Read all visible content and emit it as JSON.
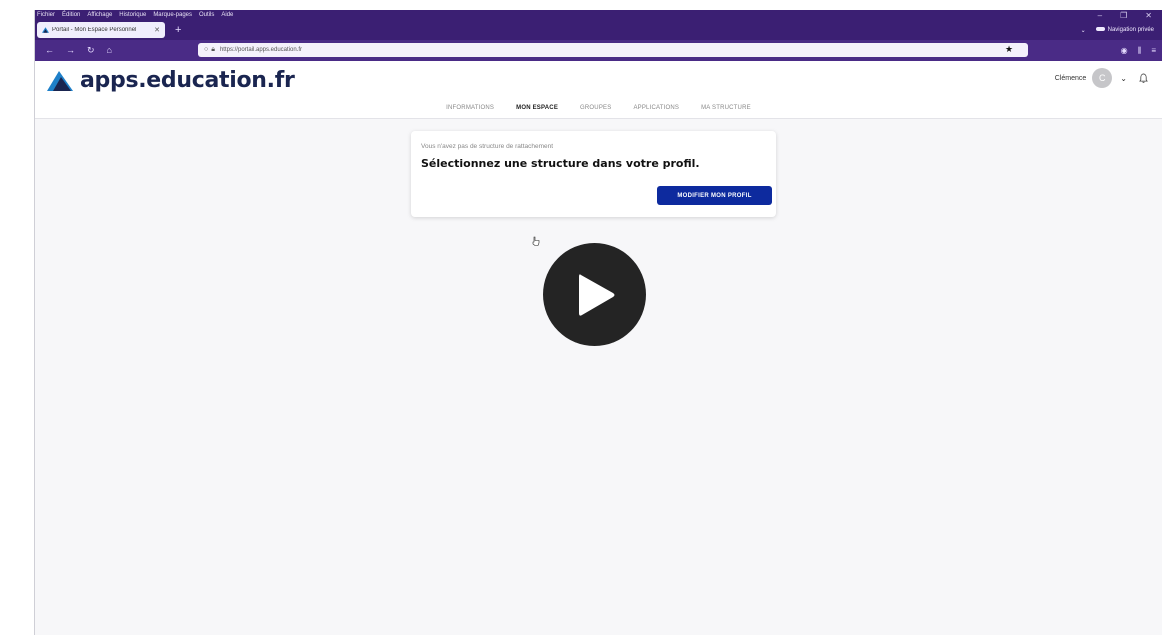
{
  "browser": {
    "menu": [
      "Fichier",
      "Édition",
      "Affichage",
      "Historique",
      "Marque-pages",
      "Outils",
      "Aide"
    ],
    "window_controls": [
      "–",
      "❐",
      "✕"
    ],
    "tab_title": "Portail - Mon Espace Personnel",
    "tab_close": "✕",
    "new_tab": "+",
    "private_label": "Navigation privée",
    "url": "https://portail.apps.education.fr",
    "nav_icons": [
      "back-icon",
      "forward-icon",
      "reload-icon",
      "home-icon"
    ]
  },
  "site": {
    "logo_text": "apps.education.fr",
    "user_name": "Clémence",
    "avatar_initial": "C"
  },
  "nav": {
    "items": [
      "INFORMATIONS",
      "MON ESPACE",
      "GROUPES",
      "APPLICATIONS",
      "MA STRUCTURE"
    ],
    "active_index": 1
  },
  "card": {
    "info": "Vous n'avez pas de structure de rattachement",
    "title": "Sélectionnez une structure dans votre profil.",
    "button": "MODIFIER MON PROFIL"
  },
  "colors": {
    "browser_purple": "#3b1f73",
    "accent_orange": "#e58b39",
    "button_blue": "#0d2a9e",
    "logo_navy": "#1a2550",
    "logo_blue": "#1f80c9"
  }
}
